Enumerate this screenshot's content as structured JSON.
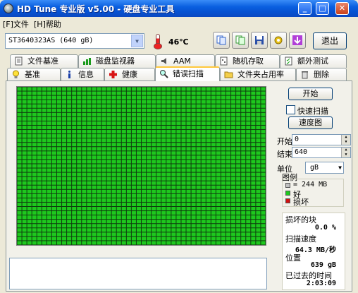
{
  "window": {
    "title": "HD Tune 专业版 v5.00 - 硬盘专业工具"
  },
  "menu": {
    "file": "[F]文件",
    "help": "[H]帮助"
  },
  "toolbar": {
    "drive": "ST3640323AS (640 gB)",
    "temperature": "46℃",
    "exit_label": "退出"
  },
  "tabs_row1": [
    {
      "label": "文件基准"
    },
    {
      "label": "磁盘监视器"
    },
    {
      "label": "AAM"
    },
    {
      "label": "随机存取"
    },
    {
      "label": "额外测试"
    }
  ],
  "tabs_row2": [
    {
      "label": "基准"
    },
    {
      "label": "信息"
    },
    {
      "label": "健康"
    },
    {
      "label": "错误扫描",
      "active": true
    },
    {
      "label": "文件夹占用率"
    },
    {
      "label": "删除"
    }
  ],
  "controls": {
    "start_label": "开始",
    "quick_scan_label": "快速扫描",
    "speed_map_label": "速度图",
    "start_field_label": "开始",
    "start_value": "0",
    "end_field_label": "结束",
    "end_value": "640",
    "unit_label": "单位",
    "unit_value": "gB"
  },
  "legend": {
    "title": "图例",
    "block_size": "= 244 MB",
    "ok": "好",
    "damaged": "损坏"
  },
  "stats": {
    "damaged_label": "损坏的块",
    "damaged_value": "0.0 %",
    "speed_label": "扫描速度",
    "speed_value": "64.3 MB/秒",
    "position_label": "位置",
    "position_value": "639 gB",
    "elapsed_label": "已过去的时间",
    "elapsed_value": "2:03:09"
  },
  "colors": {
    "ok_block": "#1ec81e",
    "damaged_block": "#d01010",
    "grid_line": "#0f3d0f",
    "unscanned": "#c0c0c0"
  },
  "icons": {
    "tab_file_benchmark": "document-icon",
    "tab_disk_monitor": "chart-icon",
    "tab_aam": "speaker-icon",
    "tab_random_access": "dice-document-icon",
    "tab_extra_tests": "checklist-icon",
    "tab_benchmark": "lightbulb-icon",
    "tab_info": "info-icon",
    "tab_health": "red-cross-icon",
    "tab_error_scan": "magnifier-icon",
    "tab_folder_usage": "folder-icon",
    "tab_erase": "trash-icon"
  }
}
